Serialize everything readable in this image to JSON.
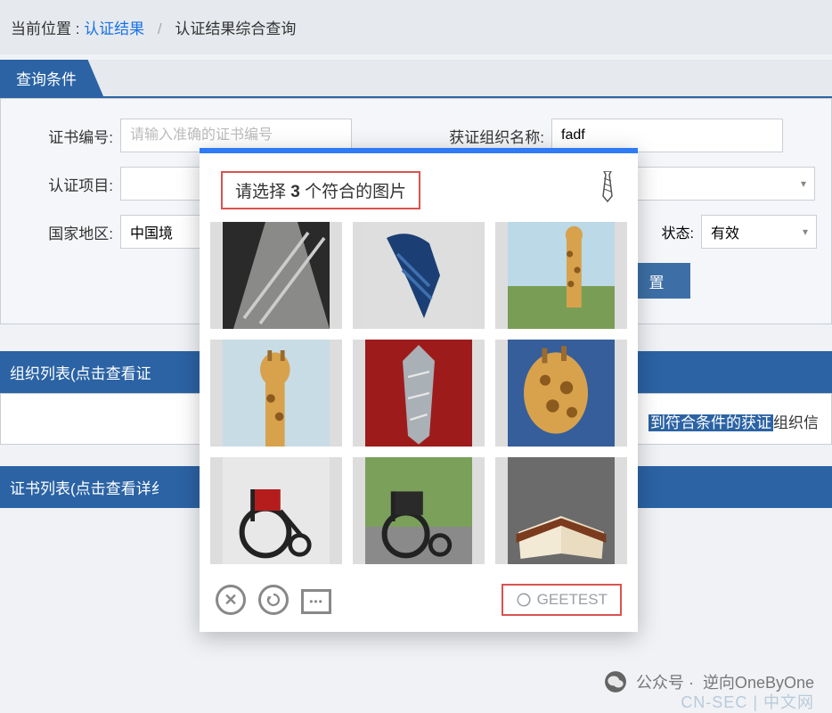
{
  "breadcrumb": {
    "label": "当前位置 :",
    "link1": "认证结果",
    "current": "认证结果综合查询"
  },
  "section_tab": "查询条件",
  "form": {
    "cert_no_label": "证书编号:",
    "cert_no_placeholder": "请输入准确的证书编号",
    "org_name_label": "获证组织名称:",
    "org_name_value": "fadf",
    "project_label": "认证项目:",
    "project_value": "",
    "region_label": "国家地区:",
    "region_value": "中国境",
    "status_label": "状态:",
    "status_value": "有效",
    "reset_btn": "置"
  },
  "org_list_header": "组织列表(点击查看证",
  "result_text_prefix": "到符合条件的获证",
  "result_text_suffix": "组织信",
  "cert_list_header": "证书列表(点击查看详纟",
  "captcha": {
    "title_prefix": "请选择 ",
    "title_count": "3",
    "title_suffix": " 个符合的图片",
    "reference_icon": "necktie-icon",
    "tiles": [
      {
        "name": "tile-tie-gray",
        "semantic": "necktie"
      },
      {
        "name": "tile-tie-blue",
        "semantic": "necktie"
      },
      {
        "name": "tile-giraffe-1",
        "semantic": "giraffe"
      },
      {
        "name": "tile-giraffe-2",
        "semantic": "giraffe"
      },
      {
        "name": "tile-tie-silver",
        "semantic": "necktie"
      },
      {
        "name": "tile-giraffe-3",
        "semantic": "giraffe"
      },
      {
        "name": "tile-wheelchair-1",
        "semantic": "wheelchair"
      },
      {
        "name": "tile-wheelchair-2",
        "semantic": "wheelchair"
      },
      {
        "name": "tile-book",
        "semantic": "open-book"
      }
    ],
    "brand": "GEETEST"
  },
  "watermark": {
    "wechat_label": "公众号 ·",
    "account": "逆向OneByOne",
    "site": "CN-SEC | 中文网"
  }
}
